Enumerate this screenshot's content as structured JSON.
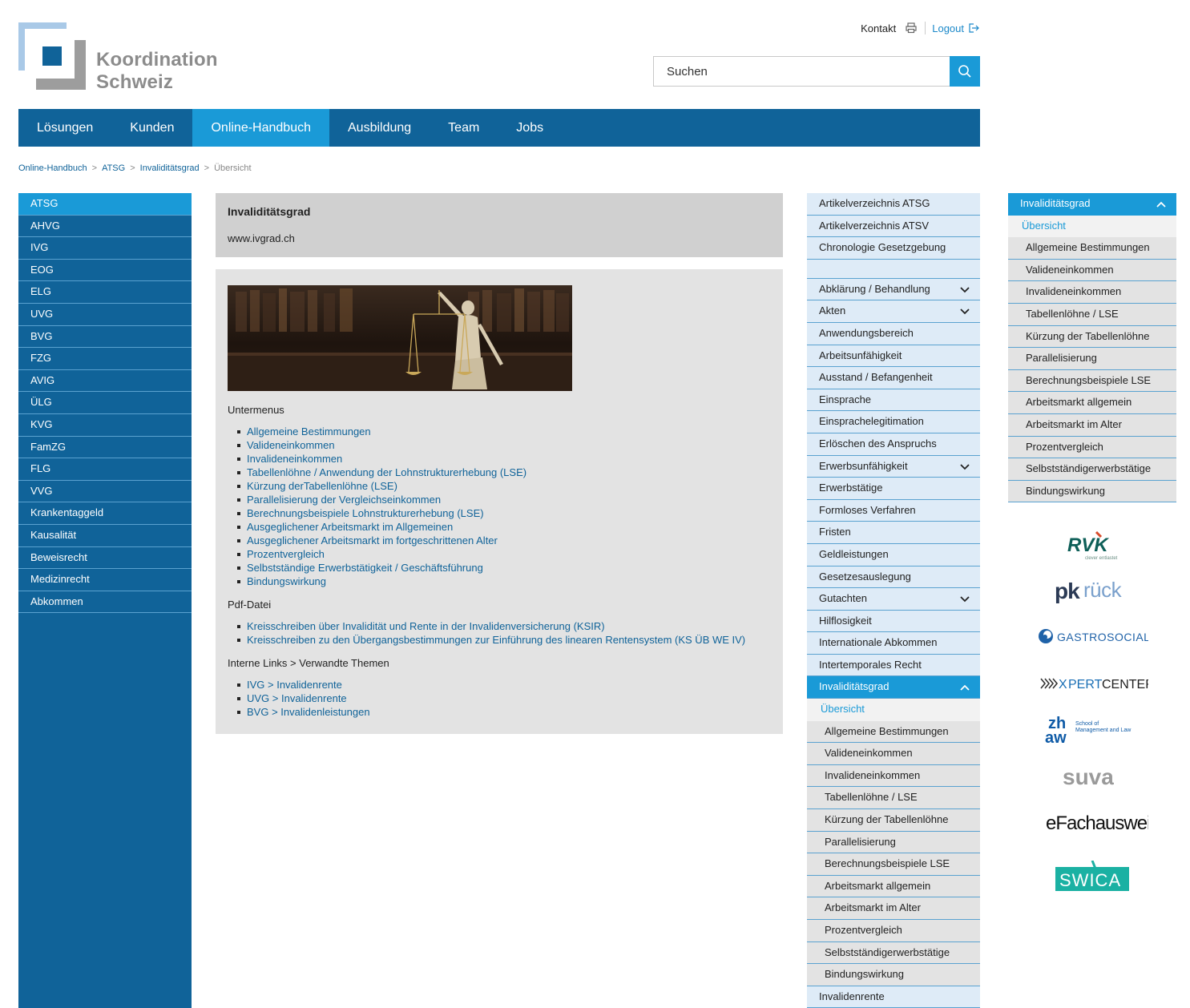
{
  "logo": {
    "line1": "Koordination",
    "line2": "Schweiz"
  },
  "topnav": {
    "contact": "Kontakt",
    "logout": "Logout"
  },
  "search": {
    "placeholder": "Suchen"
  },
  "mainnav": [
    "Lösungen",
    "Kunden",
    "Online-Handbuch",
    "Ausbildung",
    "Team",
    "Jobs"
  ],
  "mainnav_active": "Online-Handbuch",
  "breadcrumb": {
    "b1": "Online-Handbuch",
    "b2": "ATSG",
    "b3": "Invaliditätsgrad",
    "current": "Übersicht",
    "separator": ">"
  },
  "leftnav": [
    "ATSG",
    "AHVG",
    "IVG",
    "EOG",
    "ELG",
    "UVG",
    "BVG",
    "FZG",
    "AVIG",
    "ÜLG",
    "KVG",
    "FamZG",
    "FLG",
    "VVG",
    "Krankentaggeld",
    "Kausalität",
    "Beweisrecht",
    "Medizinrecht",
    "Abkommen"
  ],
  "content": {
    "title": "Invaliditätsgrad",
    "url": "www.ivgrad.ch",
    "submenus_heading": "Untermenus",
    "submenus": [
      "Allgemeine Bestimmungen",
      "Valideneinkommen",
      "Invalideneinkommen",
      "Tabellenlöhne / Anwendung der Lohnstrukturerhebung (LSE)",
      "Kürzung derTabellenlöhne (LSE)",
      "Parallelisierung der Vergleichseinkommen",
      "Berechnungsbeispiele Lohnstrukturerhebung (LSE)",
      "Ausgeglichener Arbeitsmarkt im Allgemeinen",
      "Ausgeglichener Arbeitsmarkt im fortgeschrittenen Alter",
      "Prozentvergleich",
      "Selbstständige Erwerbstätigkeit / Geschäftsführung",
      "Bindungswirkung"
    ],
    "pdf_heading": "Pdf-Datei",
    "pdfs": [
      "Kreisschreiben über Invalidität und Rente in der Invalidenversicherung (KSIR)",
      "Kreisschreiben zu den Übergangsbestimmungen zur Einführung des linearen Rentensystem (KS ÜB WE IV)"
    ],
    "links_heading": "Interne Links > Verwandte Themen",
    "links": [
      "IVG > Invalidenrente",
      "UVG > Invalidenrente",
      "BVG > Invalidenleistungen"
    ]
  },
  "midnav": {
    "top": [
      "Artikelverzeichnis ATSG",
      "Artikelverzeichnis ATSV",
      "Chronologie Gesetzgebung"
    ],
    "items": [
      {
        "label": "Abklärung / Behandlung",
        "chevron": "down"
      },
      {
        "label": "Akten",
        "chevron": "down"
      },
      {
        "label": "Anwendungsbereich"
      },
      {
        "label": "Arbeitsunfähigkeit"
      },
      {
        "label": "Ausstand / Befangenheit"
      },
      {
        "label": "Einsprache"
      },
      {
        "label": "Einsprachelegitimation"
      },
      {
        "label": "Erlöschen des Anspruchs"
      },
      {
        "label": "Erwerbsunfähigkeit",
        "chevron": "down"
      },
      {
        "label": "Erwerbstätige"
      },
      {
        "label": "Formloses Verfahren"
      },
      {
        "label": "Fristen"
      },
      {
        "label": "Geldleistungen"
      },
      {
        "label": "Gesetzesauslegung"
      },
      {
        "label": "Gutachten",
        "chevron": "down"
      },
      {
        "label": "Hilflosigkeit"
      },
      {
        "label": "Internationale Abkommen"
      },
      {
        "label": "Intertemporales Recht"
      }
    ],
    "active": "Invaliditätsgrad",
    "subhead": "Übersicht",
    "subs": [
      "Allgemeine Bestimmungen",
      "Valideneinkommen",
      "Invalideneinkommen",
      "Tabellenlöhne / LSE",
      "Kürzung der Tabellenlöhne",
      "Parallelisierung",
      "Berechnungsbeispiele LSE",
      "Arbeitsmarkt allgemein",
      "Arbeitsmarkt im Alter",
      "Prozentvergleich",
      "Selbstständigerwerbstätige",
      "Bindungswirkung"
    ],
    "after": "Invalidenrente"
  },
  "rightnav": {
    "head": "Invaliditätsgrad",
    "subhead": "Übersicht",
    "subs": [
      "Allgemeine Bestimmungen",
      "Valideneinkommen",
      "Invalideneinkommen",
      "Tabellenlöhne / LSE",
      "Kürzung der Tabellenlöhne",
      "Parallelisierung",
      "Berechnungsbeispiele LSE",
      "Arbeitsmarkt allgemein",
      "Arbeitsmarkt im Alter",
      "Prozentvergleich",
      "Selbstständigerwerbstätige",
      "Bindungswirkung"
    ]
  },
  "sponsors": [
    "RVK",
    "pkrück",
    "GASTROSOCIAL",
    "XPERTCENTER",
    "zhaw",
    "suva",
    "eFachausweis",
    "SWICA"
  ],
  "sponsor_text": {
    "rvk_tagline": "clever entlastet",
    "zhaw_sub1": "School of",
    "zhaw_sub2": "Management and Law"
  },
  "colors": {
    "dark_blue": "#106399",
    "light_blue": "#1a9ad7",
    "pale_blue": "#deebf7",
    "grey": "#e3e3e3",
    "swica": "#1bb1a3",
    "rvk": "#0e5f58"
  }
}
